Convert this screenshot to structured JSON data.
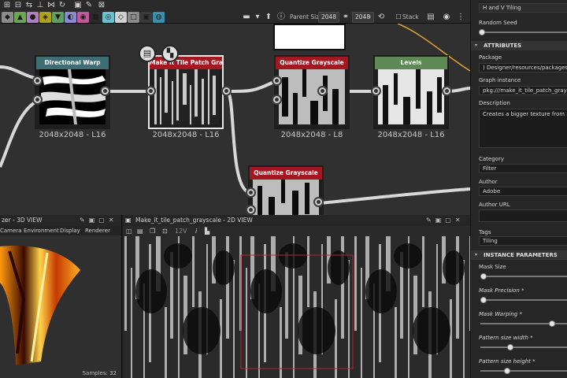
{
  "toolbar": {
    "parent_size_label": "Parent Size:",
    "parent_size_value": "2048",
    "size_value": "2048",
    "stack_label": "Stack",
    "swatch_colors": [
      "#8b8b8b",
      "#6aa84f",
      "#b07fc2",
      "#b0a020",
      "#5fa060",
      "#8a8ad0",
      "#c05a9b",
      "#2a2a2a",
      "#6abfd0",
      "#d0d0d0",
      "#8a8a8a",
      "#3a3a3a",
      "#3a8fb0"
    ]
  },
  "graph": {
    "nodes": [
      {
        "title": "Directional Warp",
        "label": "2048x2048 - L16",
        "color": "#3d6e73"
      },
      {
        "title": "Make it Tile Patch Grays...",
        "label": "2048x2048 - L16",
        "color": "#a31820"
      },
      {
        "title": "Quantize Grayscale",
        "label": "2048x2048 - L8",
        "color": "#a31820"
      },
      {
        "title": "Levels",
        "label": "2048x2048 - L16",
        "color": "#5e8a55"
      },
      {
        "title": "Quantize Grayscale",
        "label": "",
        "color": "#a31820"
      }
    ]
  },
  "view3d": {
    "title": "zer - 3D VIEW",
    "menu": [
      "Camera",
      "Environment",
      "Display",
      "Renderer"
    ],
    "samples": "Samples: 32"
  },
  "view2d": {
    "title": "Make_it_tile_patch_grayscale - 2D VIEW",
    "zoom_hint": "12V"
  },
  "props": {
    "top_item": "H and V Tiling",
    "random_seed_label": "Random Seed",
    "attributes_header": "ATTRIBUTES",
    "package_label": "Package",
    "package_value": ") Designer/resources/packages/make",
    "graph_instance_label": "Graph instance",
    "graph_instance_value": "pkg:///make_it_tile_patch_grayscale?",
    "description_label": "Description",
    "description_value": "Creates a bigger texture from a small",
    "category_label": "Category",
    "category_value": "Filter",
    "author_label": "Author",
    "author_value": "Adobe",
    "author_url_label": "Author URL",
    "author_url_value": "",
    "tags_label": "Tags",
    "tags_value": "Tiling",
    "instance_header": "INSTANCE PARAMETERS",
    "params": [
      {
        "label": "Mask Size",
        "value": 0.0
      },
      {
        "label": "Mask Precision *",
        "value": 0.0
      },
      {
        "label": "Mask Warping *",
        "value": 0.82
      },
      {
        "label": "Pattern size width *",
        "value": 0.32
      },
      {
        "label": "Pattern size height *",
        "value": 0.28
      }
    ]
  }
}
